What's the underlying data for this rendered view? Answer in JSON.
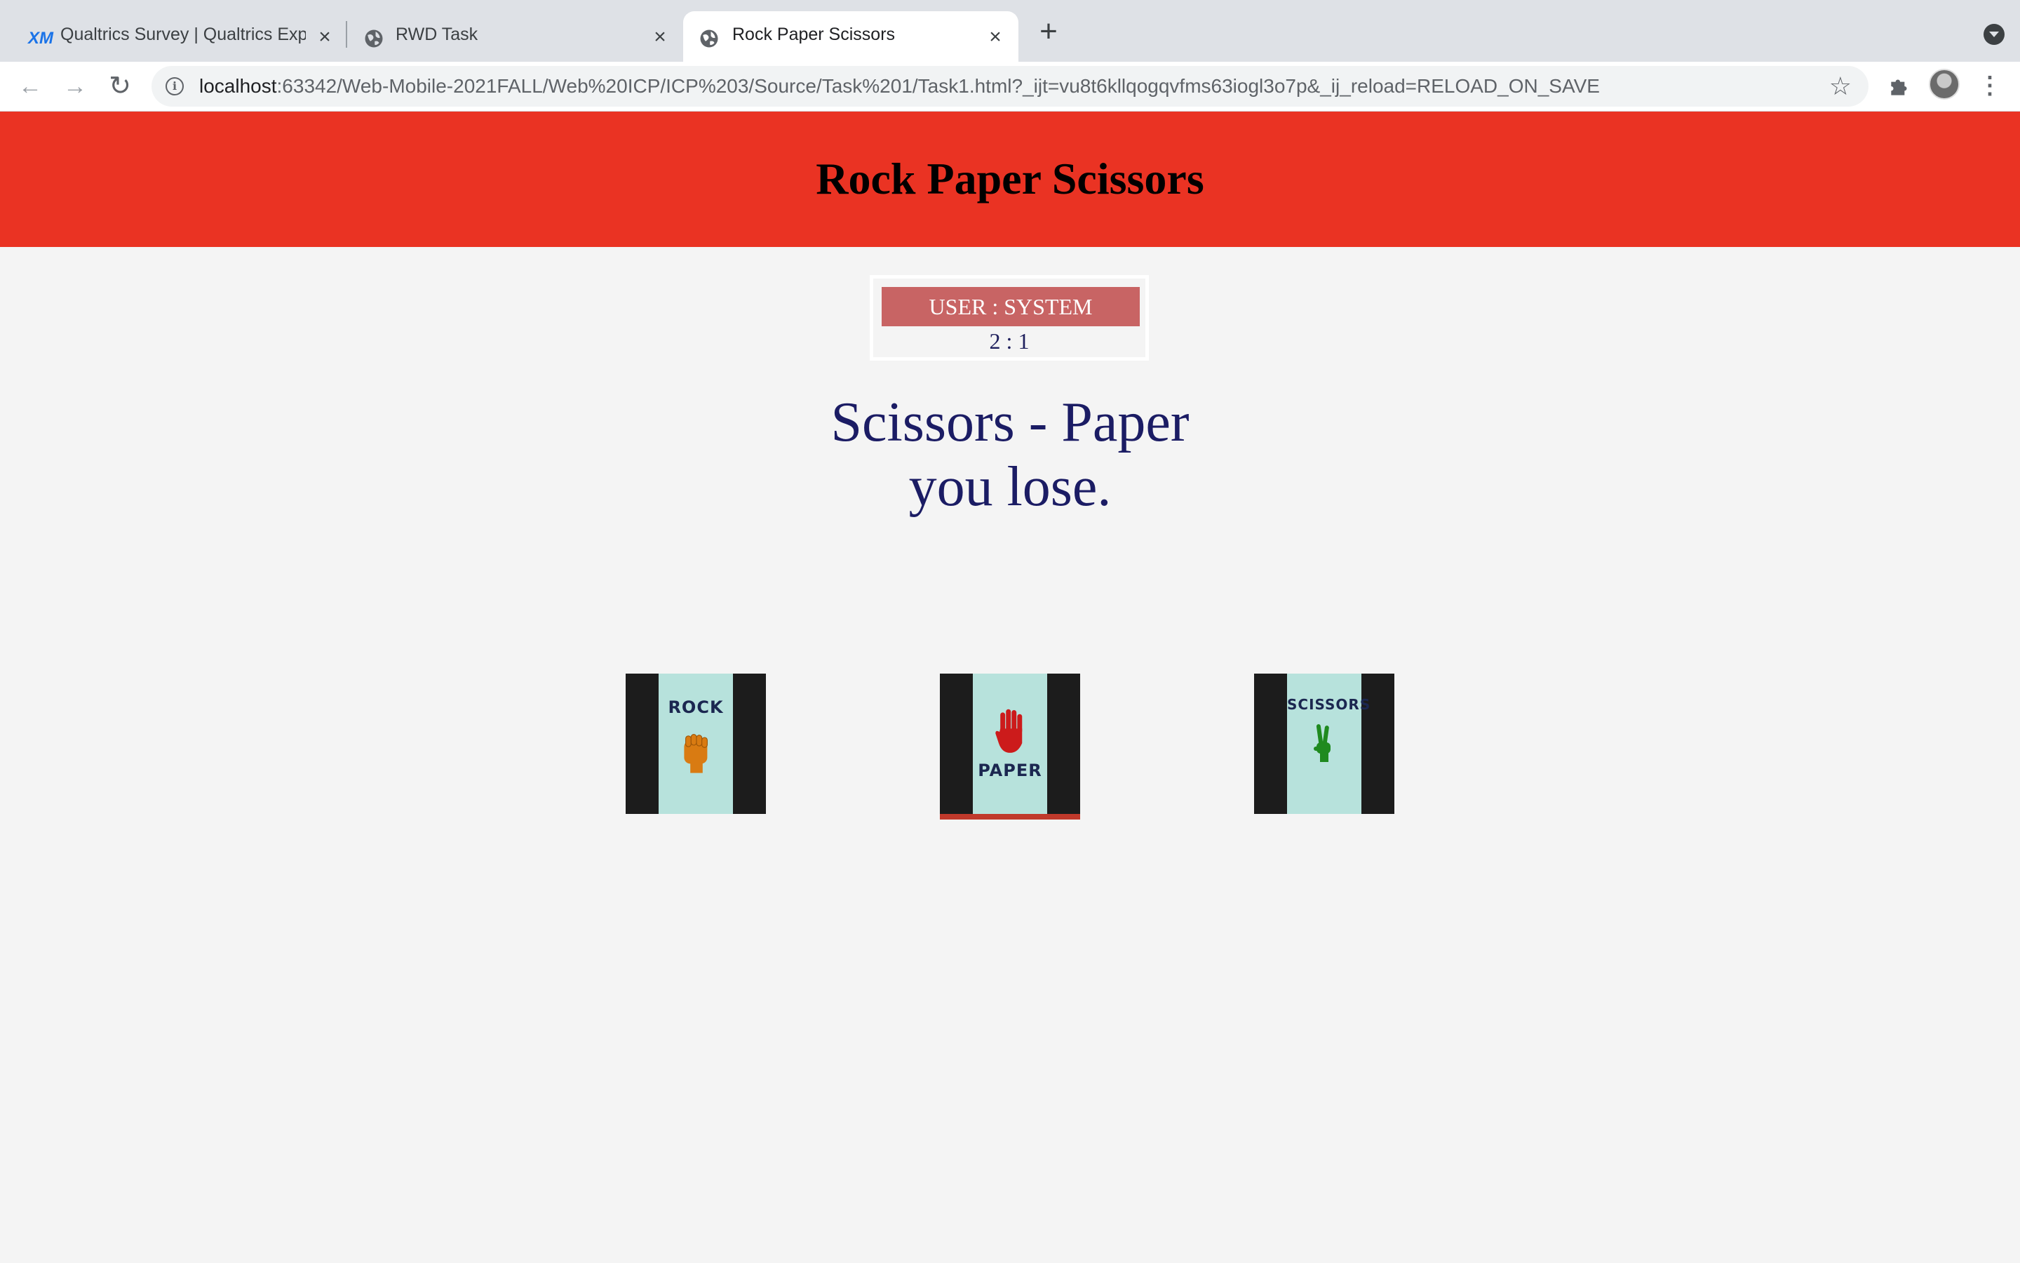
{
  "browser": {
    "tabs": [
      {
        "title": "Qualtrics Survey | Qualtrics Exp",
        "favicon": "qualtrics-xm-icon",
        "active": false
      },
      {
        "title": "RWD Task",
        "favicon": "globe-icon",
        "active": false
      },
      {
        "title": "Rock Paper Scissors",
        "favicon": "globe-icon",
        "active": true
      }
    ],
    "favicon_text": "XM",
    "url_host": "localhost",
    "url_rest": ":63342/Web-Mobile-2021FALL/Web%20ICP/ICP%203/Source/Task%201/Task1.html?_ijt=vu8t6kllqogqvfms63iogl3o7p&_ij_reload=RELOAD_ON_SAVE"
  },
  "page": {
    "title": "Rock Paper Scissors",
    "score_label": "USER : SYSTEM",
    "score_value": "2 : 1",
    "result_line1": "Scissors - Paper",
    "result_line2": "you lose.",
    "choices": [
      {
        "label": "ROCK",
        "icon": "fist-icon",
        "color": "#d97b12",
        "selected": false
      },
      {
        "label": "PAPER",
        "icon": "open-hand-icon",
        "color": "#cc1b1b",
        "selected": true
      },
      {
        "label": "SCISSORS",
        "icon": "peace-hand-icon",
        "color": "#1f8a1f",
        "selected": false
      }
    ]
  },
  "colors": {
    "header_bg": "#ea3323",
    "score_label_bg": "#c86464",
    "result_text": "#1b1c64",
    "page_bg": "#f4f4f4"
  }
}
